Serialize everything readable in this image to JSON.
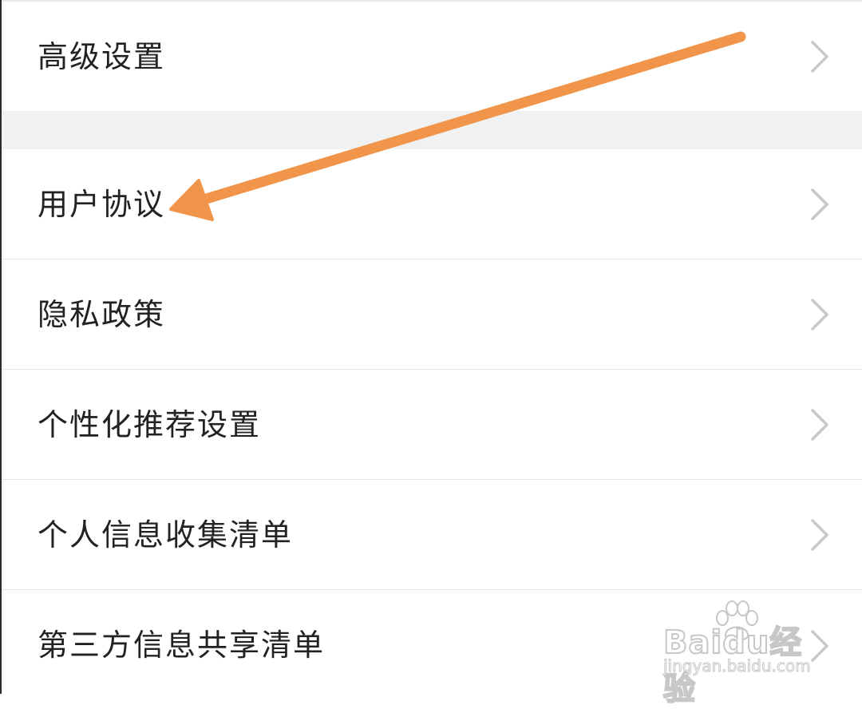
{
  "settings": {
    "items": [
      {
        "label": "高级设置",
        "chevron_icon": "chevron-right-icon"
      },
      {
        "label": "用户协议",
        "chevron_icon": "chevron-right-icon"
      },
      {
        "label": "隐私政策",
        "chevron_icon": "chevron-right-icon"
      },
      {
        "label": "个性化推荐设置",
        "chevron_icon": "chevron-right-icon"
      },
      {
        "label": "个人信息收集清单",
        "chevron_icon": "chevron-right-icon"
      },
      {
        "label": "第三方信息共享清单",
        "chevron_icon": "chevron-right-icon"
      }
    ]
  },
  "annotation": {
    "arrow_color": "#F0954A",
    "points_to": "用户协议"
  },
  "watermark": {
    "logo_text": "Baidu经验",
    "url": "jingyan.baidu.com"
  },
  "colors": {
    "background": "#FFFFFF",
    "section_gap": "#F1F1F1",
    "divider": "#E6E6E6",
    "label_text": "#222222",
    "chevron": "#C8C8C8"
  }
}
